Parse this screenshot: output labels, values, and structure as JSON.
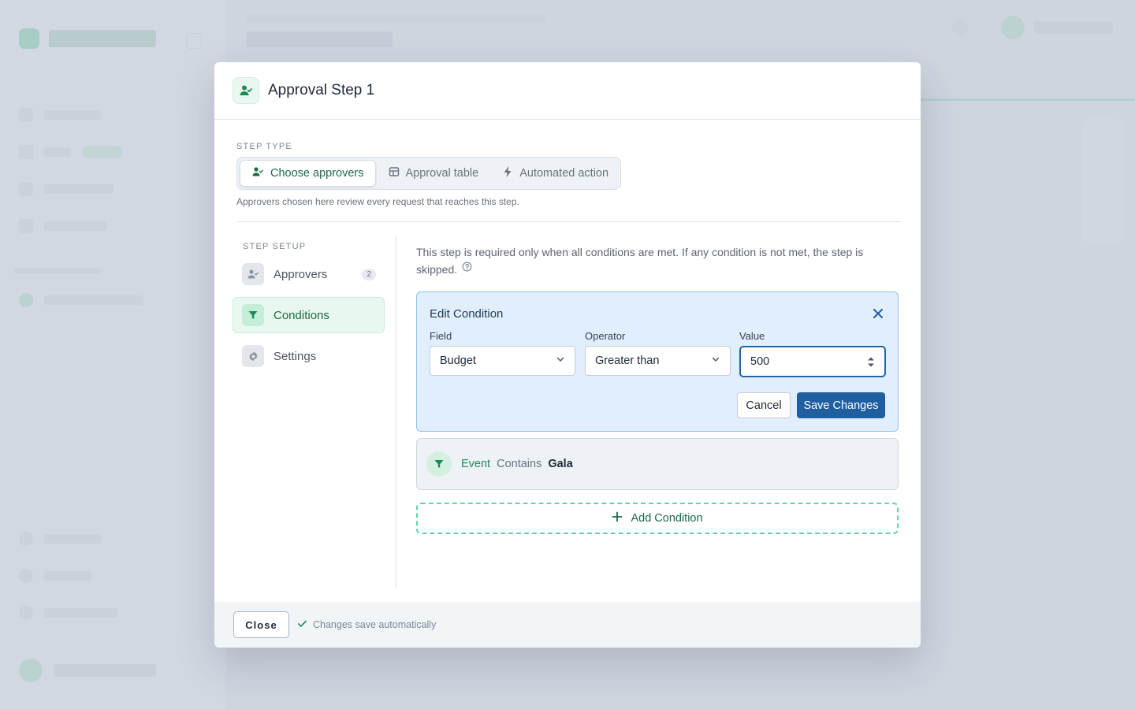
{
  "modal": {
    "title": "Approval Step 1",
    "step_type_label": "STEP TYPE",
    "step_types": [
      {
        "label": "Choose approvers",
        "icon": "user-check-icon",
        "active": true
      },
      {
        "label": "Approval table",
        "icon": "table-icon",
        "active": false
      },
      {
        "label": "Automated action",
        "icon": "lightning-icon",
        "active": false
      }
    ],
    "step_type_hint": "Approvers chosen here review every request that reaches this step.",
    "setup_label": "STEP SETUP",
    "setup_items": [
      {
        "label": "Approvers",
        "icon": "user-check-icon",
        "badge": "2",
        "active": false
      },
      {
        "label": "Conditions",
        "icon": "filter-icon",
        "active": true
      },
      {
        "label": "Settings",
        "icon": "gear-icon",
        "active": false
      }
    ],
    "conditions": {
      "intro": "This step is required only when all conditions are met. If any condition is not met, the step is skipped.",
      "edit": {
        "title": "Edit Condition",
        "field_label": "Field",
        "field_value": "Budget",
        "operator_label": "Operator",
        "operator_value": "Greater than",
        "value_label": "Value",
        "value": "500",
        "cancel_label": "Cancel",
        "save_label": "Save Changes"
      },
      "existing": [
        {
          "field": "Event",
          "operator": "Contains",
          "value": "Gala"
        }
      ],
      "add_label": "Add Condition"
    },
    "footer": {
      "close_label": "Close",
      "autosave": "Changes save automatically"
    }
  },
  "colors": {
    "brand_green": "#1d6b45",
    "accent_blue": "#1f5fa0",
    "edit_card_bg": "#e1eefb"
  }
}
